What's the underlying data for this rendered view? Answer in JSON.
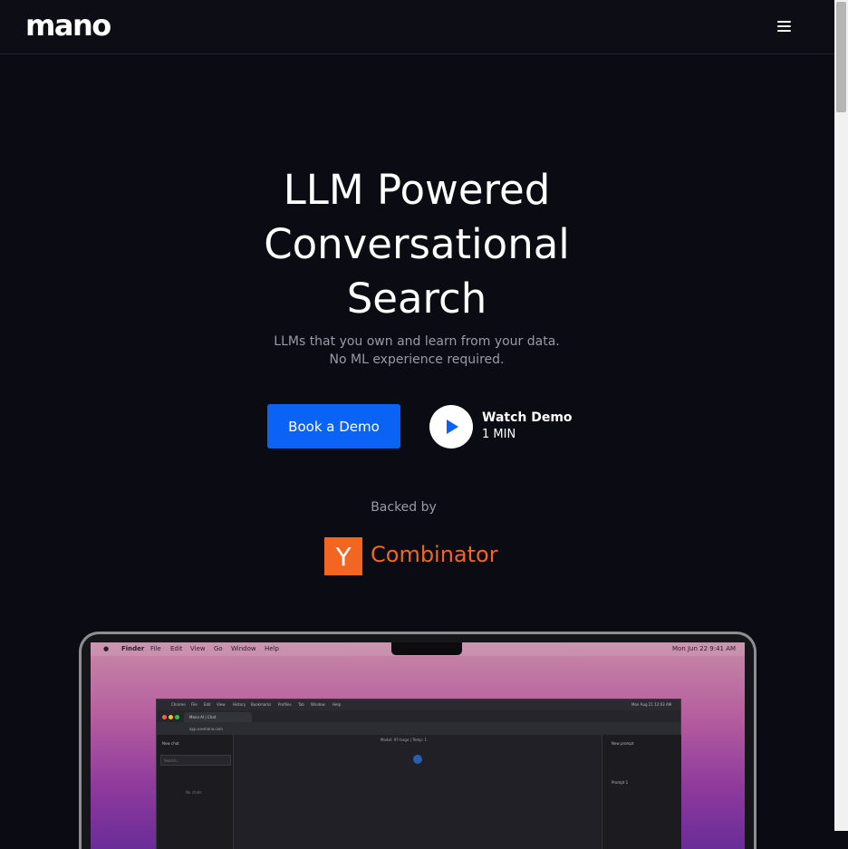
{
  "nav": {
    "logo": "mano",
    "menu_icon": "hamburger-menu-icon"
  },
  "hero": {
    "title": "LLM Powered Conversational Search",
    "subtitle_line1": "LLMs that you own and learn from your data.",
    "subtitle_line2": "No ML experience required.",
    "book_demo_label": "Book a Demo",
    "watch_demo_title": "Watch Demo",
    "watch_demo_length": "1 MIN",
    "play_icon": "play-icon"
  },
  "backing": {
    "label": "Backed by",
    "yc_letter": "Y",
    "yc_name": "Combinator"
  },
  "colors": {
    "background": "#0b0b14",
    "primary_button": "#0a63f5",
    "yc_orange": "#f26522"
  },
  "laptop": {
    "mac_menu": [
      "Finder",
      "File",
      "Edit",
      "View",
      "Go",
      "Window",
      "Help"
    ],
    "mac_clock": "Mon Jun 22  9:41 AM",
    "browser_menu": [
      "Chrome",
      "File",
      "Edit",
      "View",
      "History",
      "Bookmarks",
      "Profiles",
      "Tab",
      "Window",
      "Help"
    ],
    "browser_clock": "Mon Aug 21  12:03 AM",
    "tab_title": "Mano AI | Chat",
    "address": "app.usemano.com",
    "new_chat": "New chat",
    "search_placeholder": "Search...",
    "no_chats": "No chats",
    "model_label": "Model: 97-large | Temp: 1",
    "new_prompt": "New prompt",
    "prompt_item": "Prompt 1"
  }
}
